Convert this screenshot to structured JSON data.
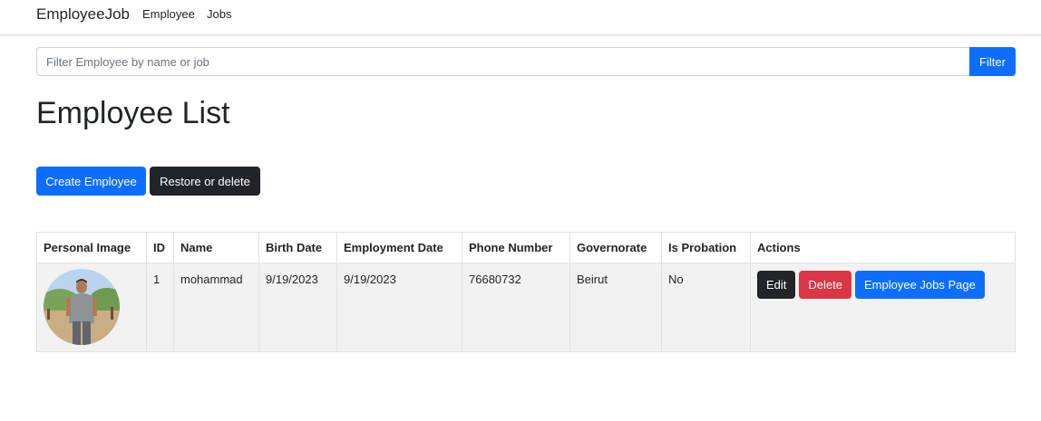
{
  "nav": {
    "brand": "EmployeeJob",
    "links": [
      "Employee",
      "Jobs"
    ]
  },
  "search": {
    "placeholder": "Filter Employee by name or job",
    "value": "",
    "button": "Filter"
  },
  "page": {
    "title": "Employee List",
    "create_label": "Create Employee",
    "restore_label": "Restore or delete"
  },
  "table": {
    "headers": [
      "Personal Image",
      "ID",
      "Name",
      "Birth Date",
      "Employment Date",
      "Phone Number",
      "Governorate",
      "Is Probation",
      "Actions"
    ],
    "rows": [
      {
        "id": "1",
        "name": "mohammad",
        "birth_date": "9/19/2023",
        "employment_date": "9/19/2023",
        "phone": "76680732",
        "governorate": "Beirut",
        "probation": "No",
        "actions": {
          "edit": "Edit",
          "delete": "Delete",
          "jobs": "Employee Jobs Page"
        }
      }
    ]
  },
  "colors": {
    "primary": "#0d6efd",
    "dark": "#212529",
    "danger": "#dc3545",
    "row_bg": "#f2f2f2"
  }
}
